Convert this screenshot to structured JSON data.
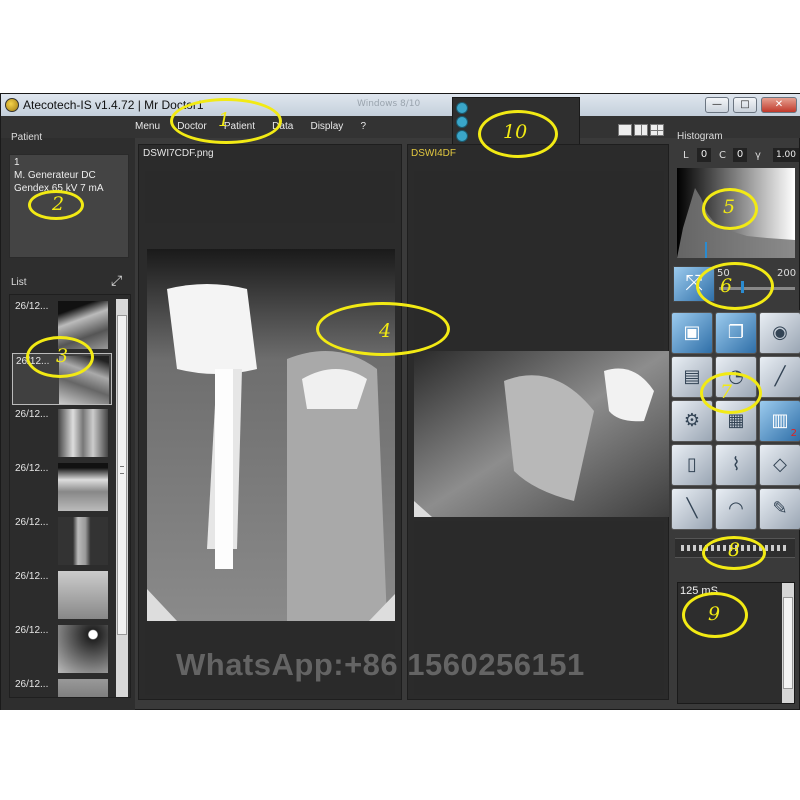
{
  "titlebar": {
    "app_title": "Atecotech-IS v1.4.72 | Mr  Doctor1",
    "ghost_title": "Windows 8/10",
    "minimize": "—",
    "maximize": "□",
    "close": "✕"
  },
  "menu": [
    "Menu",
    "Doctor",
    "Patient",
    "Data",
    "Display",
    "?"
  ],
  "patient": {
    "title": "Patient",
    "lines": [
      "1",
      "M. Generateur DC",
      "Gendex 65 kV 7 mA"
    ]
  },
  "list": {
    "title": "List",
    "thumb_labels": [
      "26/12...",
      "26/12...",
      "26/12...",
      "26/12...",
      "26/12...",
      "26/12...",
      "26/12...",
      "26/12..."
    ]
  },
  "viewers": {
    "left_file": "DSWI7CDF.png",
    "right_file": "DSWI4DF"
  },
  "histogram": {
    "title": "Histogram",
    "L_label": "L",
    "L_value": "0",
    "C_label": "C",
    "C_value": "0",
    "gamma_label": "γ",
    "gamma_value": "1.00"
  },
  "slider": {
    "min_label": "50",
    "max_label": "200"
  },
  "tools_badge": "2",
  "info": {
    "text": "125 mS"
  },
  "annotations": [
    "1",
    "2",
    "3",
    "4",
    "5",
    "6",
    "7",
    "8",
    "9",
    "10"
  ],
  "watermark": "WhatsApp:+86 15602561​51",
  "colors": {
    "annotation": "#f2ea14",
    "selected_file": "#e2c840",
    "panel_bg": "#2e2e2e",
    "window_bg": "#3a3a3a"
  }
}
